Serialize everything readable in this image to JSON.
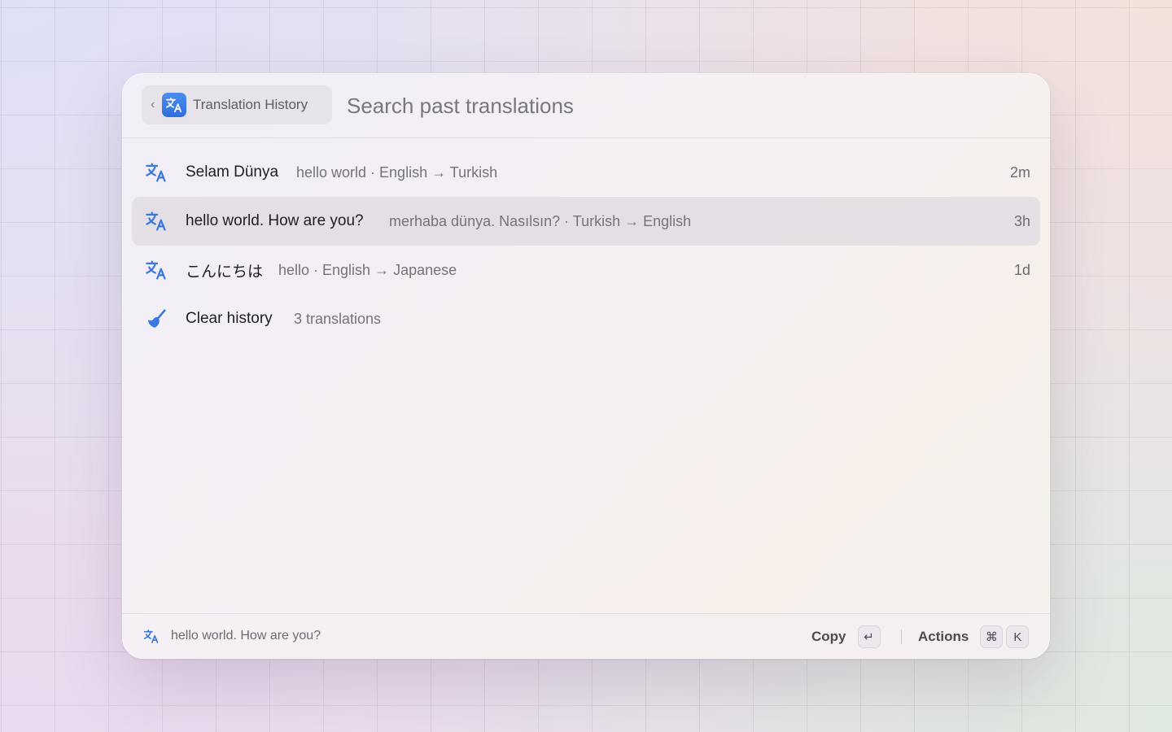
{
  "header": {
    "breadcrumb_label": "Translation History",
    "search_placeholder": "Search past translations",
    "search_value": ""
  },
  "items": [
    {
      "title": "Selam Dünya",
      "subtitle": "hello world · English → Turkish",
      "time": "2m",
      "icon": "translate-icon",
      "selected": false
    },
    {
      "title": "hello world. How are you?",
      "subtitle": "merhaba dünya. Nasılsın? · Turkish → English",
      "time": "3h",
      "icon": "translate-icon",
      "selected": true
    },
    {
      "title": "こんにちは",
      "subtitle": "hello · English → Japanese",
      "time": "1d",
      "icon": "translate-icon",
      "selected": false
    },
    {
      "title": "Clear history",
      "subtitle": "3 translations",
      "time": "",
      "icon": "broom-icon",
      "selected": false
    }
  ],
  "footer": {
    "selection_text": "hello world. How are you?",
    "primary_action_label": "Copy",
    "primary_action_key": "↵",
    "secondary_action_label": "Actions",
    "secondary_action_keys": [
      "⌘",
      "K"
    ]
  },
  "colors": {
    "accent": "#3a78e0",
    "selection": "#e3dfe4"
  }
}
